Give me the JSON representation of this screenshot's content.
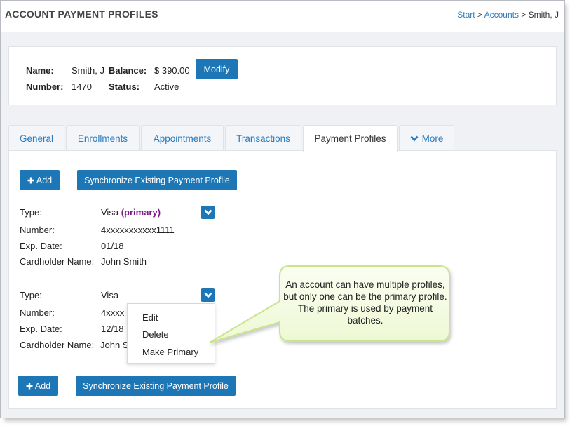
{
  "header": {
    "title": "ACCOUNT PAYMENT PROFILES",
    "breadcrumb": {
      "start": "Start",
      "sep1": " > ",
      "accounts": "Accounts",
      "sep2": " > ",
      "current": "Smith, J"
    }
  },
  "account": {
    "name_label": "Name:",
    "name": "Smith, J",
    "balance_label": "Balance:",
    "balance": "$ 390.00",
    "number_label": "Number:",
    "number": "1470",
    "status_label": "Status:",
    "status": "Active",
    "modify_label": "Modify"
  },
  "tabs": [
    {
      "label": "General"
    },
    {
      "label": "Enrollments"
    },
    {
      "label": "Appointments"
    },
    {
      "label": "Transactions"
    },
    {
      "label": "Payment Profiles",
      "active": true
    },
    {
      "label": "More",
      "icon": "chevron-down-icon"
    }
  ],
  "actions": {
    "add_label": "Add",
    "sync_label": "Synchronize Existing Payment Profile"
  },
  "labels": {
    "type": "Type:",
    "number": "Number:",
    "exp": "Exp. Date:",
    "cardholder": "Cardholder Name:"
  },
  "profiles": [
    {
      "type": "Visa",
      "primary_tag": "(primary)",
      "number": "4xxxxxxxxxxx1111",
      "exp": "01/18",
      "cardholder": "John Smith"
    },
    {
      "type": "Visa",
      "number_visible": "4xxxx",
      "exp": "12/18",
      "cardholder_visible": "John S"
    }
  ],
  "dropdown": {
    "items": [
      "Edit",
      "Delete",
      "Make Primary"
    ]
  },
  "callout": {
    "text": "An account can have multiple profiles, but only one can be the primary profile. The primary is used by payment batches."
  },
  "colors": {
    "button": "#1d76b6",
    "link": "#2a7cbf",
    "primary_tag": "#7a1a86",
    "callout_fill": "#f4fbe3",
    "callout_border": "#c8e58a"
  }
}
